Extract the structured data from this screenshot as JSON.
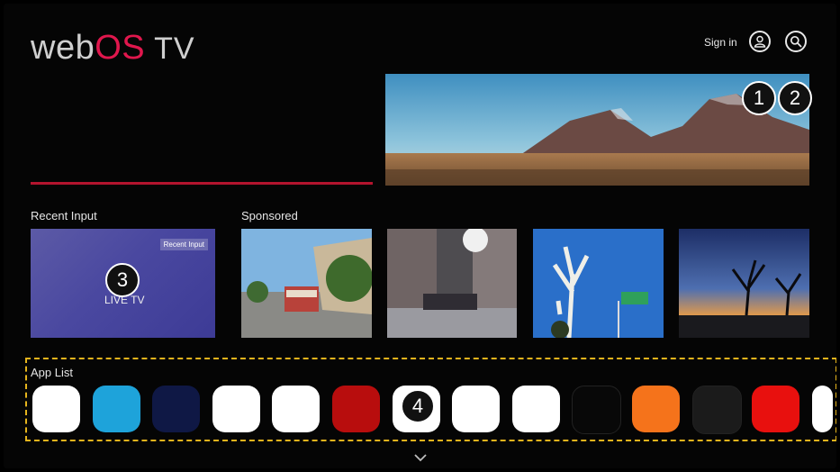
{
  "brand": {
    "prefix": "web",
    "os": "OS",
    "tv": "TV"
  },
  "header": {
    "signin_label": "Sign in"
  },
  "sections": {
    "recent_input_label": "Recent Input",
    "sponsored_label": "Sponsored",
    "app_list_label": "App List"
  },
  "recent_card": {
    "tag": "Recent Input",
    "title": "LIVE TV"
  },
  "callouts": [
    "1",
    "2",
    "3",
    "4"
  ],
  "apps": [
    {
      "color": "#ffffff"
    },
    {
      "color": "#1ea3da"
    },
    {
      "color": "#0f1845"
    },
    {
      "color": "#ffffff"
    },
    {
      "color": "#ffffff"
    },
    {
      "color": "#b80d0d"
    },
    {
      "color": "#ffffff"
    },
    {
      "color": "#ffffff"
    },
    {
      "color": "#ffffff"
    },
    {
      "color": "#080808"
    },
    {
      "color": "#f5731b"
    },
    {
      "color": "#1b1b1b"
    },
    {
      "color": "#e8100e"
    },
    {
      "color": "#ffffff"
    }
  ],
  "colors": {
    "accent": "#e0174d",
    "focus_line": "#b4142e",
    "callout_outline": "#e5b41c"
  }
}
